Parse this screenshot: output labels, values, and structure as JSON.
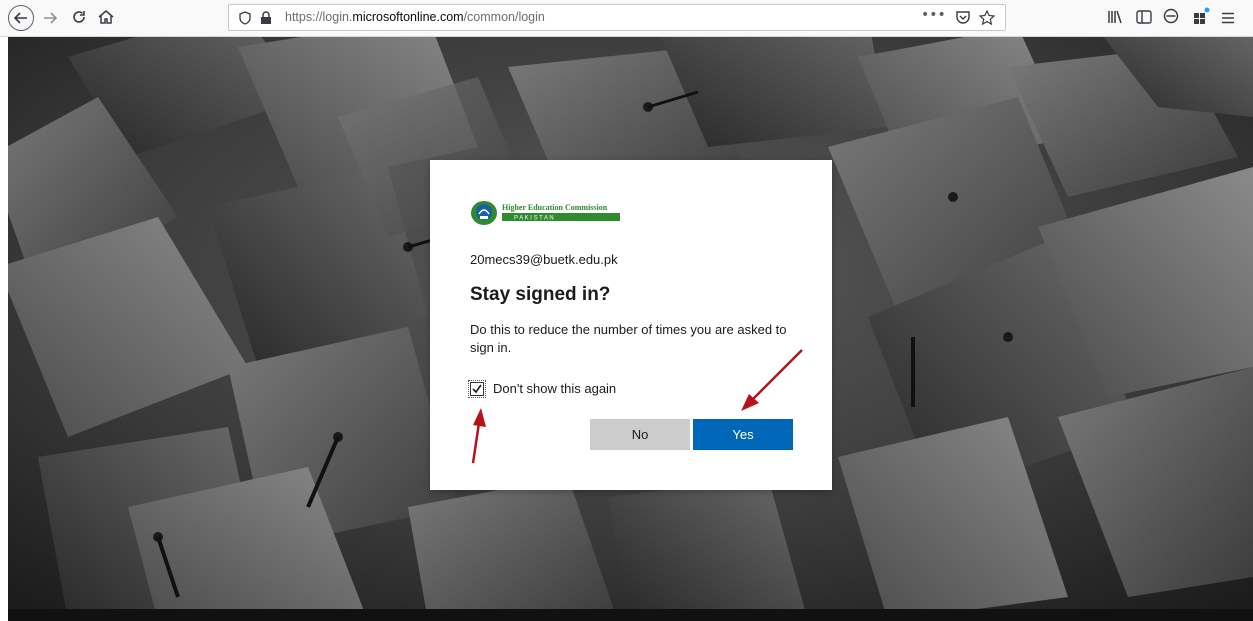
{
  "browser": {
    "url_prefix": "https://login.",
    "url_host": "microsoftonline.com",
    "url_path": "/common/login",
    "icons": {
      "back": "back-arrow-icon",
      "forward": "forward-arrow-icon",
      "reload": "reload-icon",
      "home": "home-icon",
      "tracking": "shield-icon",
      "lock": "lock-icon",
      "page_actions": "ellipsis-icon",
      "pocket": "pocket-icon",
      "bookmark": "star-icon",
      "library": "library-icon",
      "sidebar": "sidebar-icon",
      "account": "account-icon",
      "extensions": "extensions-icon",
      "menu": "hamburger-menu-icon"
    }
  },
  "dialog": {
    "logo_text_top": "Higher Education Commission",
    "logo_text_bottom": "P A K I S T A N",
    "email": "20mecs39@buetk.edu.pk",
    "title": "Stay signed in?",
    "description": "Do this to reduce the number of times you are asked to sign in.",
    "checkbox_label": "Don't show this again",
    "checkbox_checked": true,
    "no_label": "No",
    "yes_label": "Yes"
  },
  "colors": {
    "primary_button": "#0067b8",
    "secondary_button": "#cccccc",
    "annotation_arrow": "#b3141b",
    "logo_green": "#2e8b2e"
  }
}
